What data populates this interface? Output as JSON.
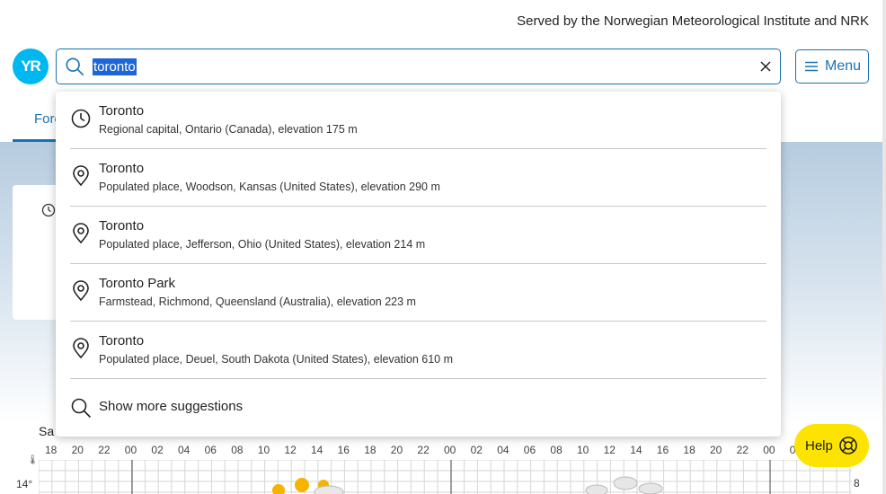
{
  "header": {
    "served_by": "Served by the Norwegian Meteorological Institute and NRK",
    "logo_text": "YR",
    "menu_label": "Menu"
  },
  "search": {
    "value": "toronto",
    "placeholder": ""
  },
  "tab": {
    "label": "Fore"
  },
  "suggestions": [
    {
      "icon": "clock-icon",
      "name": "Toronto",
      "desc": "Regional capital, Ontario (Canada), elevation 175 m"
    },
    {
      "icon": "location-pin-icon",
      "name": "Toronto",
      "desc": "Populated place, Woodson, Kansas (United States), elevation 290 m"
    },
    {
      "icon": "location-pin-icon",
      "name": "Toronto",
      "desc": "Populated place, Jefferson, Ohio (United States), elevation 214 m"
    },
    {
      "icon": "location-pin-icon",
      "name": "Toronto Park",
      "desc": "Farmstead, Richmond, Queensland (Australia), elevation 223 m"
    },
    {
      "icon": "location-pin-icon",
      "name": "Toronto",
      "desc": "Populated place, Deuel, South Dakota (United States), elevation 610 m"
    }
  ],
  "more_suggestions": "Show more suggestions",
  "help_label": "Help",
  "forecast": {
    "day_label": "Sa",
    "hours": [
      "18",
      "20",
      "22",
      "00",
      "02",
      "04",
      "06",
      "08",
      "10",
      "12",
      "14",
      "16",
      "18",
      "20",
      "22",
      "00",
      "02",
      "04",
      "06",
      "08",
      "10",
      "12",
      "14",
      "16",
      "18",
      "20",
      "22",
      "00",
      "0"
    ],
    "temp_label": "14°",
    "right_value": "8"
  },
  "colors": {
    "accent": "#1a73b0",
    "logo": "#00b8f1",
    "help": "#fde400",
    "selection": "#1c66d6"
  }
}
